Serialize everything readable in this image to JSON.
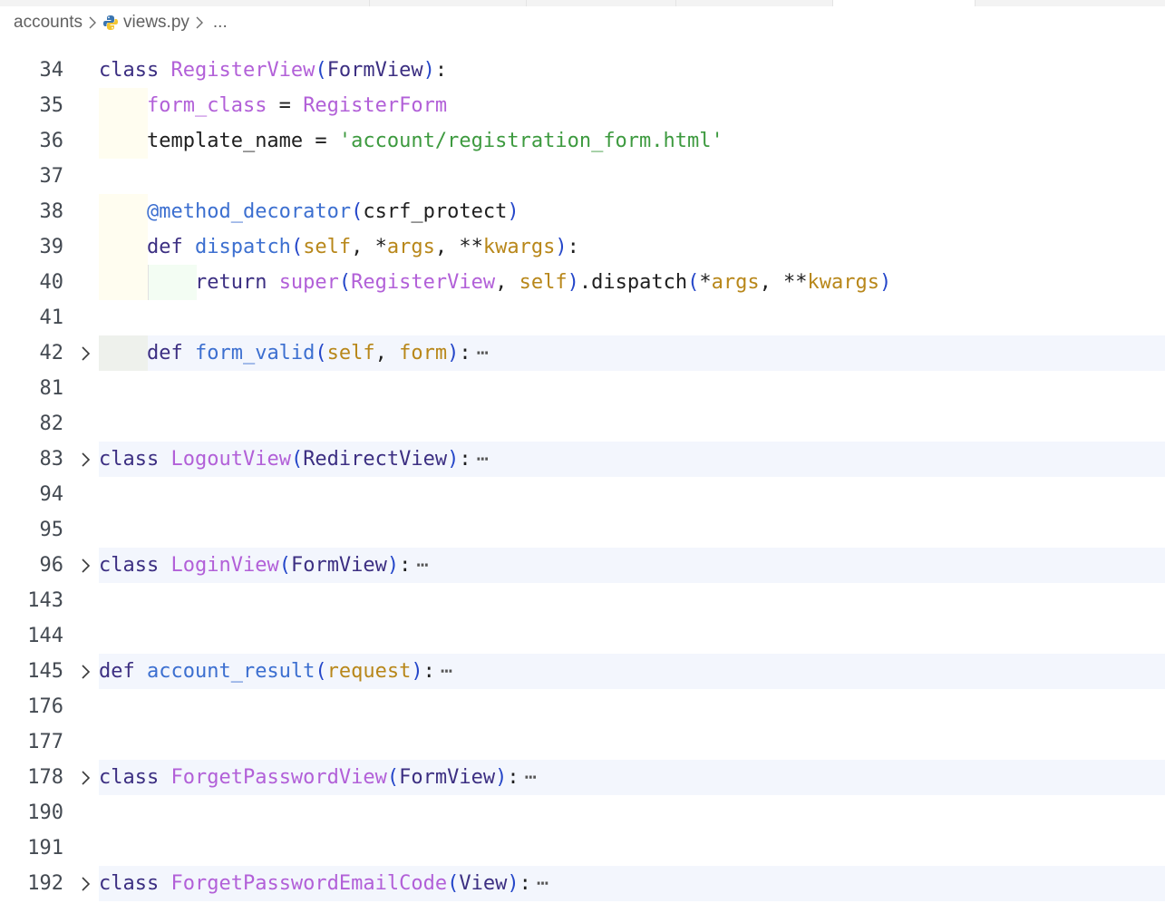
{
  "breadcrumb": {
    "folder": "accounts",
    "file": "views.py",
    "ellipsis": "..."
  },
  "lines": [
    {
      "n": "34",
      "tokens": [
        {
          "t": "class ",
          "c": "kw"
        },
        {
          "t": "RegisterView",
          "c": "cls"
        },
        {
          "t": "(",
          "c": "br1"
        },
        {
          "t": "FormView",
          "c": "kw"
        },
        {
          "t": ")",
          "c": "br1"
        },
        {
          "t": ":",
          "c": "op"
        }
      ]
    },
    {
      "n": "35",
      "indent": 1,
      "tokens": [
        {
          "t": "    ",
          "c": "op"
        },
        {
          "t": "form_class",
          "c": "cls"
        },
        {
          "t": " = ",
          "c": "op"
        },
        {
          "t": "RegisterForm",
          "c": "cls"
        }
      ]
    },
    {
      "n": "36",
      "indent": 1,
      "tokens": [
        {
          "t": "    ",
          "c": "op"
        },
        {
          "t": "template_name",
          "c": "op"
        },
        {
          "t": " = ",
          "c": "op"
        },
        {
          "t": "'account/registration_form.html'",
          "c": "str"
        }
      ]
    },
    {
      "n": "37",
      "tokens": []
    },
    {
      "n": "38",
      "indent": 1,
      "tokens": [
        {
          "t": "    ",
          "c": "op"
        },
        {
          "t": "@method_decorator",
          "c": "fn"
        },
        {
          "t": "(",
          "c": "br1"
        },
        {
          "t": "csrf_protect",
          "c": "op"
        },
        {
          "t": ")",
          "c": "br1"
        }
      ]
    },
    {
      "n": "39",
      "indent": 1,
      "tokens": [
        {
          "t": "    ",
          "c": "op"
        },
        {
          "t": "def ",
          "c": "kw"
        },
        {
          "t": "dispatch",
          "c": "fn"
        },
        {
          "t": "(",
          "c": "br1"
        },
        {
          "t": "self",
          "c": "par"
        },
        {
          "t": ", *",
          "c": "op"
        },
        {
          "t": "args",
          "c": "par"
        },
        {
          "t": ", **",
          "c": "op"
        },
        {
          "t": "kwargs",
          "c": "par"
        },
        {
          "t": ")",
          "c": "br1"
        },
        {
          "t": ":",
          "c": "op"
        }
      ]
    },
    {
      "n": "40",
      "indent": 2,
      "tokens": [
        {
          "t": "        ",
          "c": "op"
        },
        {
          "t": "return ",
          "c": "kw"
        },
        {
          "t": "super",
          "c": "cls"
        },
        {
          "t": "(",
          "c": "br1"
        },
        {
          "t": "RegisterView",
          "c": "cls"
        },
        {
          "t": ", ",
          "c": "op"
        },
        {
          "t": "self",
          "c": "par"
        },
        {
          "t": ")",
          "c": "br1"
        },
        {
          "t": ".dispatch",
          "c": "op"
        },
        {
          "t": "(",
          "c": "br1"
        },
        {
          "t": "*",
          "c": "op"
        },
        {
          "t": "args",
          "c": "par"
        },
        {
          "t": ", **",
          "c": "op"
        },
        {
          "t": "kwargs",
          "c": "par"
        },
        {
          "t": ")",
          "c": "br1"
        }
      ]
    },
    {
      "n": "41",
      "tokens": []
    },
    {
      "n": "42",
      "folded": true,
      "indent": 1,
      "tokens": [
        {
          "t": "    ",
          "c": "op"
        },
        {
          "t": "def ",
          "c": "kw"
        },
        {
          "t": "form_valid",
          "c": "fn"
        },
        {
          "t": "(",
          "c": "br1"
        },
        {
          "t": "self",
          "c": "par"
        },
        {
          "t": ", ",
          "c": "op"
        },
        {
          "t": "form",
          "c": "par"
        },
        {
          "t": ")",
          "c": "br1"
        },
        {
          "t": ":",
          "c": "op"
        }
      ]
    },
    {
      "n": "81",
      "tokens": []
    },
    {
      "n": "82",
      "tokens": []
    },
    {
      "n": "83",
      "folded": true,
      "tokens": [
        {
          "t": "class ",
          "c": "kw"
        },
        {
          "t": "LogoutView",
          "c": "cls"
        },
        {
          "t": "(",
          "c": "br1"
        },
        {
          "t": "RedirectView",
          "c": "kw"
        },
        {
          "t": ")",
          "c": "br1"
        },
        {
          "t": ":",
          "c": "op"
        }
      ]
    },
    {
      "n": "94",
      "tokens": []
    },
    {
      "n": "95",
      "tokens": []
    },
    {
      "n": "96",
      "folded": true,
      "tokens": [
        {
          "t": "class ",
          "c": "kw"
        },
        {
          "t": "LoginView",
          "c": "cls"
        },
        {
          "t": "(",
          "c": "br1"
        },
        {
          "t": "FormView",
          "c": "kw"
        },
        {
          "t": ")",
          "c": "br1"
        },
        {
          "t": ":",
          "c": "op"
        }
      ]
    },
    {
      "n": "143",
      "tokens": []
    },
    {
      "n": "144",
      "tokens": []
    },
    {
      "n": "145",
      "folded": true,
      "tokens": [
        {
          "t": "def ",
          "c": "kw"
        },
        {
          "t": "account_result",
          "c": "fn"
        },
        {
          "t": "(",
          "c": "br1"
        },
        {
          "t": "request",
          "c": "par"
        },
        {
          "t": ")",
          "c": "br1"
        },
        {
          "t": ":",
          "c": "op"
        }
      ]
    },
    {
      "n": "176",
      "tokens": []
    },
    {
      "n": "177",
      "tokens": []
    },
    {
      "n": "178",
      "folded": true,
      "tokens": [
        {
          "t": "class ",
          "c": "kw"
        },
        {
          "t": "ForgetPasswordView",
          "c": "cls"
        },
        {
          "t": "(",
          "c": "br1"
        },
        {
          "t": "FormView",
          "c": "kw"
        },
        {
          "t": ")",
          "c": "br1"
        },
        {
          "t": ":",
          "c": "op"
        }
      ]
    },
    {
      "n": "190",
      "tokens": []
    },
    {
      "n": "191",
      "tokens": []
    },
    {
      "n": "192",
      "folded": true,
      "tokens": [
        {
          "t": "class ",
          "c": "kw"
        },
        {
          "t": "ForgetPasswordEmailCode",
          "c": "cls"
        },
        {
          "t": "(",
          "c": "br1"
        },
        {
          "t": "View",
          "c": "kw"
        },
        {
          "t": ")",
          "c": "br1"
        },
        {
          "t": ":",
          "c": "op"
        }
      ]
    }
  ],
  "fold_ellipsis": "⋯",
  "colors": {
    "keyword": "#3c2f82",
    "class_name": "#b260d8",
    "function": "#3c6fd0",
    "parameter": "#b8871a",
    "string": "#3d9a3f",
    "folded_line_bg": "#f3f6fd"
  },
  "icons": {
    "breadcrumb_separator": "chevron-right-icon",
    "file": "python-icon",
    "fold": "chevron-right-icon"
  }
}
